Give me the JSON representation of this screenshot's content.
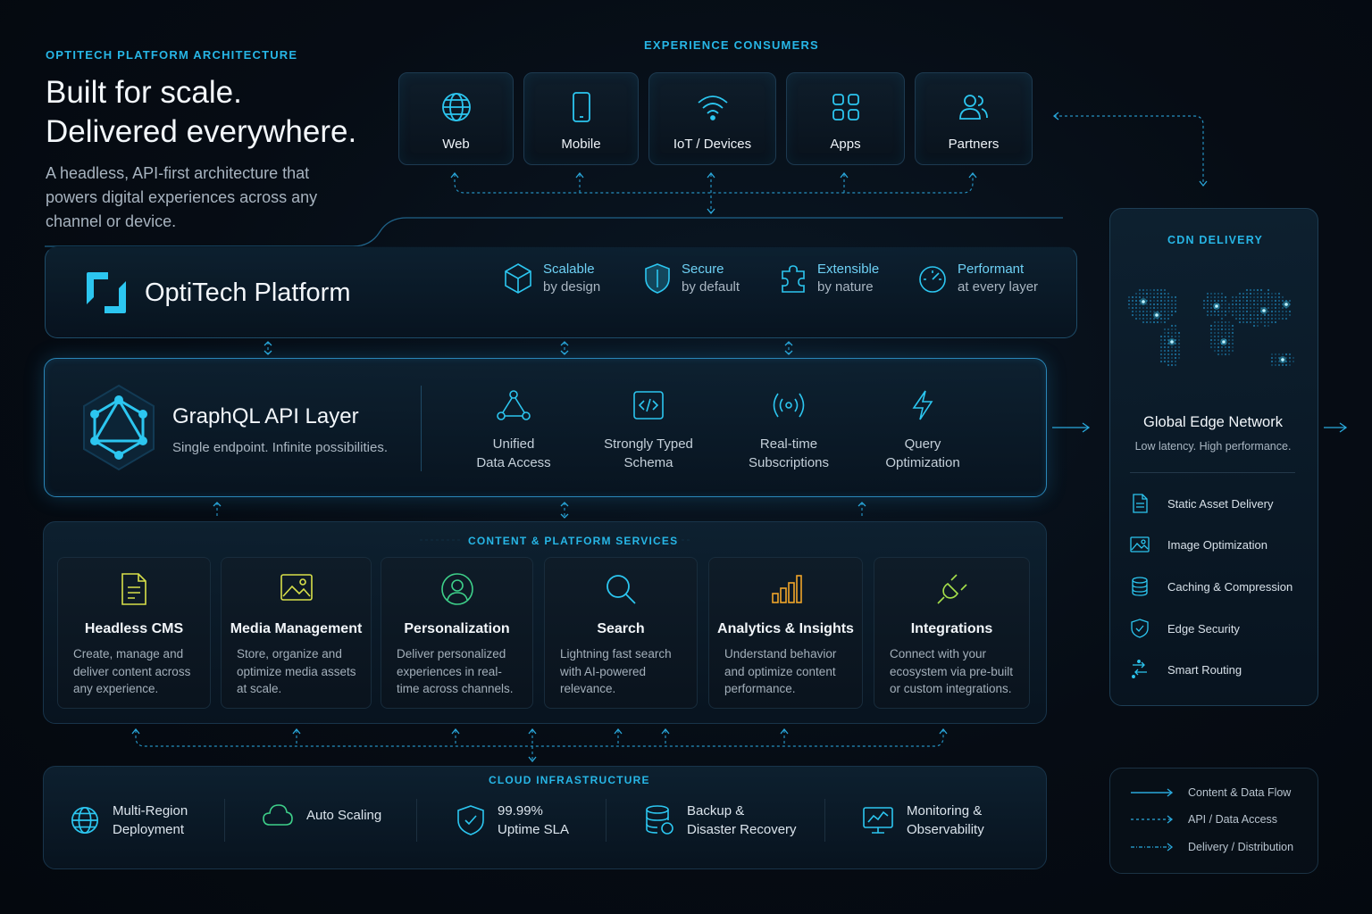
{
  "header": {
    "eyebrow": "OPTITECH PLATFORM ARCHITECTURE",
    "title_line1": "Built for scale.",
    "title_line2": "Delivered everywhere.",
    "subtitle": "A headless, API-first architecture that powers digital experiences across any channel or device."
  },
  "consumers": {
    "heading": "EXPERIENCE CONSUMERS",
    "items": [
      {
        "label": "Web",
        "icon": "globe-icon"
      },
      {
        "label": "Mobile",
        "icon": "mobile-phone-icon"
      },
      {
        "label": "IoT / Devices",
        "icon": "wifi-icon"
      },
      {
        "label": "Apps",
        "icon": "apps-grid-icon"
      },
      {
        "label": "Partners",
        "icon": "users-icon"
      }
    ]
  },
  "platform": {
    "name": "OptiTech Platform",
    "features": [
      {
        "title": "Scalable",
        "sub": "by design",
        "icon": "cube-icon"
      },
      {
        "title": "Secure",
        "sub": "by default",
        "icon": "shield-icon"
      },
      {
        "title": "Extensible",
        "sub": "by nature",
        "icon": "puzzle-icon"
      },
      {
        "title": "Performant",
        "sub": "at every layer",
        "icon": "gauge-icon"
      }
    ]
  },
  "graphql": {
    "title": "GraphQL API Layer",
    "subtitle": "Single endpoint. Infinite possibilities.",
    "features": [
      {
        "line1": "Unified",
        "line2": "Data Access",
        "icon": "nodes-icon"
      },
      {
        "line1": "Strongly Typed",
        "line2": "Schema",
        "icon": "code-icon"
      },
      {
        "line1": "Real-time",
        "line2": "Subscriptions",
        "icon": "broadcast-icon"
      },
      {
        "line1": "Query",
        "line2": "Optimization",
        "icon": "lightning-icon"
      }
    ]
  },
  "services": {
    "heading": "CONTENT & PLATFORM SERVICES",
    "items": [
      {
        "title": "Headless CMS",
        "desc": "Create, manage and deliver content across any experience.",
        "icon": "document-icon",
        "color": "#d8e04a"
      },
      {
        "title": "Media Management",
        "desc": "Store, organize and optimize media assets at scale.",
        "icon": "image-icon",
        "color": "#d8e04a"
      },
      {
        "title": "Personalization",
        "desc": "Deliver personalized experiences in real-time across channels.",
        "icon": "user-circle-icon",
        "color": "#3ed08a"
      },
      {
        "title": "Search",
        "desc": "Lightning fast search with AI-powered relevance.",
        "icon": "search-icon",
        "color": "#2cc6f0"
      },
      {
        "title": "Analytics & Insights",
        "desc": "Understand behavior and optimize content performance.",
        "icon": "bar-chart-icon",
        "color": "#f0a52a"
      },
      {
        "title": "Integrations",
        "desc": "Connect with your ecosystem via pre-built or custom integrations.",
        "icon": "plug-icon",
        "color": "#a6e04a"
      }
    ]
  },
  "infrastructure": {
    "heading": "CLOUD INFRASTRUCTURE",
    "items": [
      {
        "line1": "Multi-Region",
        "line2": "Deployment",
        "icon": "globe-icon"
      },
      {
        "line1": "Auto Scaling",
        "line2": "",
        "icon": "cloud-icon"
      },
      {
        "line1": "99.99%",
        "line2": "Uptime SLA",
        "icon": "shield-check-icon"
      },
      {
        "line1": "Backup &",
        "line2": "Disaster Recovery",
        "icon": "database-icon"
      },
      {
        "line1": "Monitoring &",
        "line2": "Observability",
        "icon": "monitor-chart-icon"
      }
    ]
  },
  "cdn": {
    "heading": "CDN DELIVERY",
    "title": "Global Edge Network",
    "subtitle": "Low latency. High performance.",
    "items": [
      {
        "label": "Static Asset Delivery",
        "icon": "file-icon"
      },
      {
        "label": "Image Optimization",
        "icon": "image-icon"
      },
      {
        "label": "Caching & Compression",
        "icon": "database-icon"
      },
      {
        "label": "Edge Security",
        "icon": "shield-icon"
      },
      {
        "label": "Smart Routing",
        "icon": "routing-icon"
      }
    ]
  },
  "legend": [
    {
      "label": "Content & Data Flow",
      "style": "solid"
    },
    {
      "label": "API / Data Access",
      "style": "dashed"
    },
    {
      "label": "Delivery / Distribution",
      "style": "dashed-arrow"
    }
  ],
  "colors": {
    "accent": "#2cc6f0",
    "panel_border": "#2a86b8",
    "background": "#060c14"
  }
}
